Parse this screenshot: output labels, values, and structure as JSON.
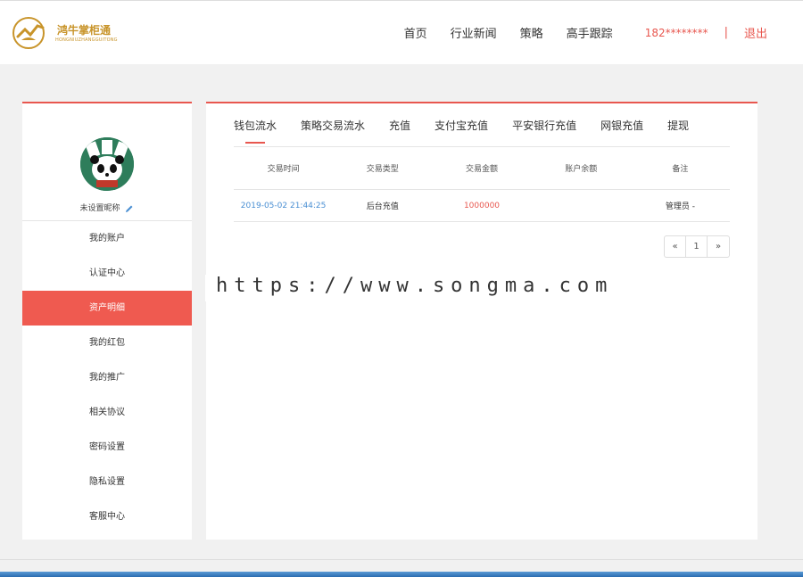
{
  "header": {
    "logo_text": "鸿牛掌柜通",
    "logo_sub": "HONGNIUZHANGGUITONG",
    "nav": [
      "首页",
      "行业新闻",
      "策略",
      "高手跟踪"
    ],
    "phone": "182********",
    "separator": "|",
    "logout": "退出"
  },
  "sidebar": {
    "nickname": "未设置昵称",
    "items": [
      {
        "label": "我的账户"
      },
      {
        "label": "认证中心"
      },
      {
        "label": "资产明细",
        "active": true
      },
      {
        "label": "我的红包"
      },
      {
        "label": "我的推广"
      },
      {
        "label": "相关协议"
      },
      {
        "label": "密码设置"
      },
      {
        "label": "隐私设置"
      },
      {
        "label": "客服中心"
      }
    ]
  },
  "main": {
    "tabs": [
      "钱包流水",
      "策略交易流水",
      "充值",
      "支付宝充值",
      "平安银行充值",
      "网银充值",
      "提现"
    ],
    "active_tab": "钱包流水",
    "table": {
      "columns": [
        "交易时间",
        "交易类型",
        "交易金额",
        "账户余额",
        "备注"
      ],
      "rows": [
        {
          "time": "2019-05-02 21:44:25",
          "type": "后台充值",
          "amount": "1000000",
          "balance": "",
          "note": "管理员 -"
        }
      ]
    },
    "pager": {
      "prev": "«",
      "page": "1",
      "next": "»"
    }
  },
  "watermark": "https://www.songma.com",
  "colors": {
    "accent": "#e8574f",
    "link": "#4a8fd3",
    "active_menu": "#ef5a50"
  }
}
